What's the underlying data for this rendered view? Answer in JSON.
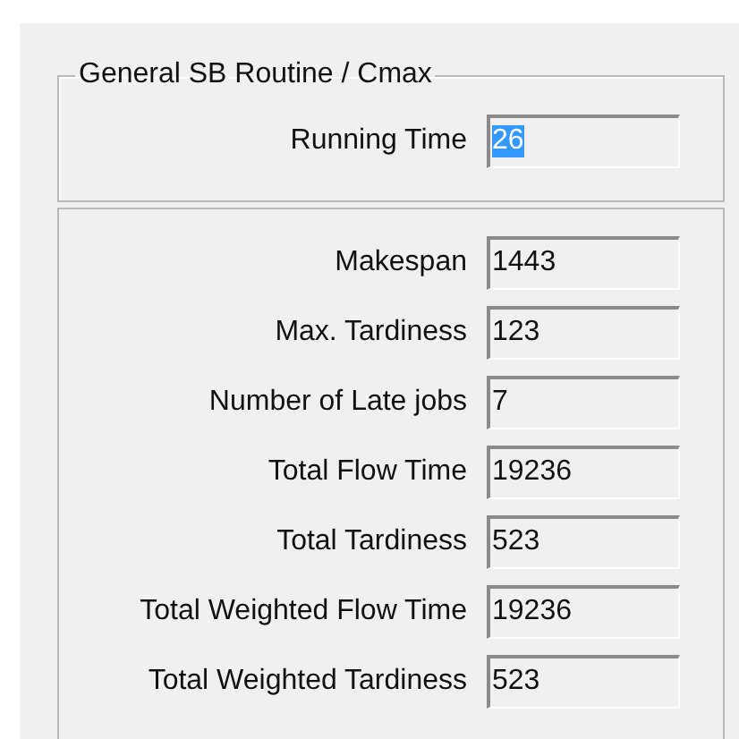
{
  "group": {
    "title": "General SB Routine / Cmax",
    "fields": [
      {
        "label": "Running Time",
        "value": "26",
        "selected": true
      }
    ]
  },
  "results": [
    {
      "label": "Makespan",
      "value": "1443"
    },
    {
      "label": "Max. Tardiness",
      "value": "123"
    },
    {
      "label": "Number of Late jobs",
      "value": "7"
    },
    {
      "label": "Total Flow Time",
      "value": "19236"
    },
    {
      "label": "Total Tardiness",
      "value": "523"
    },
    {
      "label": "Total Weighted Flow Time",
      "value": "19236"
    },
    {
      "label": "Total Weighted Tardiness",
      "value": "523"
    }
  ]
}
